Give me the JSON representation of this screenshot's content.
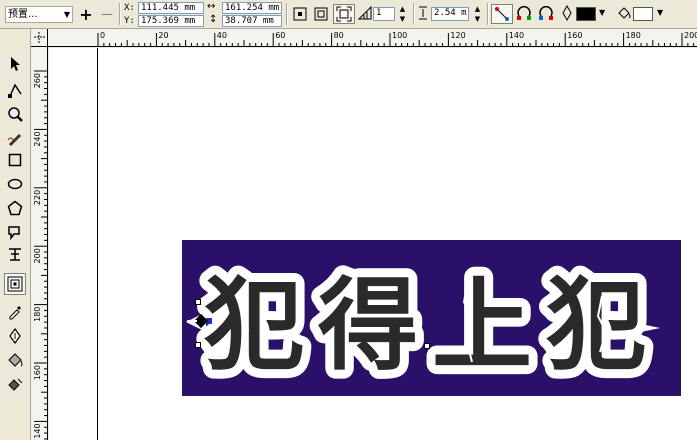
{
  "propbar": {
    "preset_label": "预置...",
    "add_label": "+",
    "remove_label": "—",
    "x_label": "X:",
    "x_value": "111.445 mm",
    "y_label": "Y:",
    "y_value": "175.369 mm",
    "width_value": "161.254 mm",
    "height_value": "38.707 mm",
    "steps_value": "1",
    "offset_value": "2.54 m",
    "outline_color": "#000000",
    "fill_color": "#ffffff"
  },
  "ruler_top": {
    "ticks": [
      "0",
      "20",
      "40",
      "60",
      "80",
      "100",
      "120",
      "140",
      "160",
      "180",
      "200"
    ]
  },
  "ruler_left": {
    "ticks": [
      "260",
      "240",
      "220",
      "200",
      "180",
      "160",
      "140"
    ]
  },
  "canvas": {
    "banner_color": "#2b1069",
    "banner_text": "犯得上犯",
    "text_fill": "#2a2a2a",
    "contour_color": "#ffffff",
    "selection_color": "#1a2dcc"
  },
  "tools": [
    {
      "name": "pick-tool-icon"
    },
    {
      "name": "shape-tool-icon"
    },
    {
      "name": "zoom-tool-icon"
    },
    {
      "name": "freehand-tool-icon"
    },
    {
      "name": "rectangle-tool-icon"
    },
    {
      "name": "ellipse-tool-icon"
    },
    {
      "name": "polygon-tool-icon"
    },
    {
      "name": "basic-shapes-tool-icon"
    },
    {
      "name": "text-tool-icon"
    },
    {
      "name": "contour-tool-icon"
    },
    {
      "name": "eyedropper-tool-icon"
    },
    {
      "name": "outline-tool-icon"
    },
    {
      "name": "fill-tool-icon"
    },
    {
      "name": "interactive-fill-tool-icon"
    }
  ]
}
